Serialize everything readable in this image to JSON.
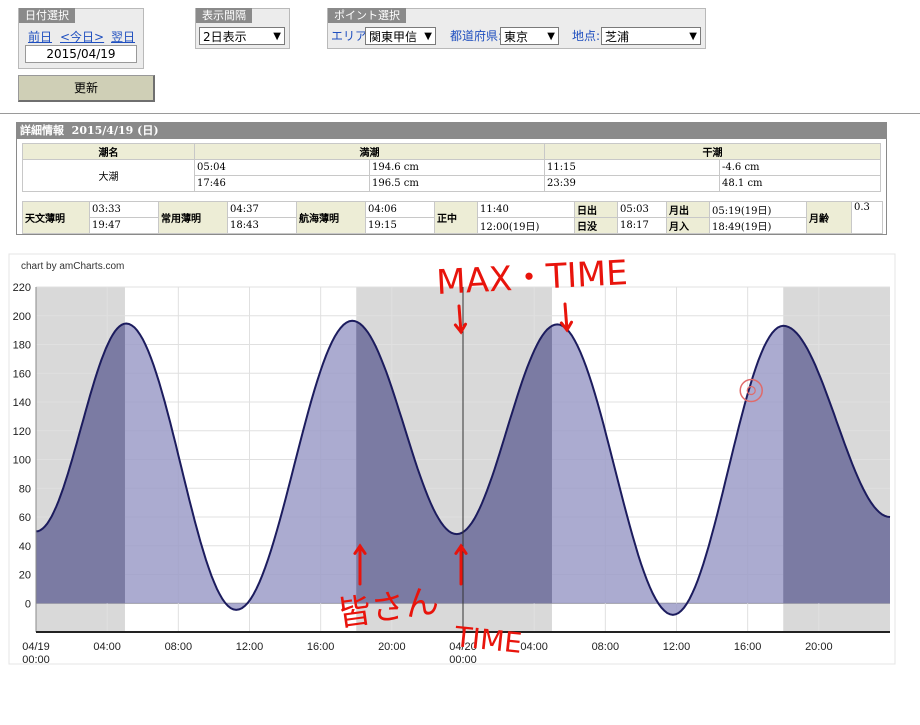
{
  "date_select": {
    "title": "日付選択",
    "prev": "前日",
    "today": "<今日>",
    "next": "翌日",
    "date": "2015/04/19"
  },
  "interval": {
    "title": "表示間隔",
    "value": "2日表示"
  },
  "point_select": {
    "title": "ポイント選択",
    "area_label": "エリア:",
    "area_value": "関東甲信",
    "pref_label": "都道府県:",
    "pref_value": "東京",
    "spot_label": "地点:",
    "spot_value": "芝浦"
  },
  "update_button": "更新",
  "details": {
    "title": "詳細情報",
    "date": "2015/4/19 (日)",
    "tide_headers": [
      "潮名",
      "満潮",
      "干潮"
    ],
    "tide_name": "大潮",
    "high": [
      {
        "time": "05:04",
        "level": "194.6 cm"
      },
      {
        "time": "17:46",
        "level": "196.5 cm"
      }
    ],
    "low": [
      {
        "time": "11:15",
        "level": "-4.6 cm"
      },
      {
        "time": "23:39",
        "level": "48.1 cm"
      }
    ],
    "info": {
      "astro_twilight": {
        "label": "天文薄明",
        "start": "03:33",
        "end": "19:47"
      },
      "civil_twilight": {
        "label": "常用薄明",
        "start": "04:37",
        "end": "18:43"
      },
      "nautical_twilight": {
        "label": "航海薄明",
        "start": "04:06",
        "end": "19:15"
      },
      "noon": {
        "label": "正中",
        "v1": "11:40",
        "v2": "12:00(19日)"
      },
      "sunrise": {
        "label": "日出",
        "value": "05:03"
      },
      "sunset": {
        "label": "日没",
        "value": "18:17"
      },
      "moonrise": {
        "label": "月出",
        "value": "05:19(19日)"
      },
      "moonset": {
        "label": "月入",
        "value": "18:49(19日)"
      },
      "moon_age": {
        "label": "月齢",
        "value": "0.3"
      }
    }
  },
  "chart_credit": "chart by amCharts.com",
  "annotations": {
    "max_time": "MAX・TIME",
    "minasan": "皆さん",
    "time": "TIME"
  },
  "colors": {
    "night_band": "#d9d9d9",
    "fill_day": "#9c9cc8",
    "fill_night": "#7b7ba3",
    "line": "#1c1c5e",
    "annotation": "#e8140c"
  },
  "chart_data": {
    "type": "area",
    "title": "",
    "xlabel": "",
    "ylabel": "",
    "ylim": [
      -20,
      220
    ],
    "yticks": [
      0,
      20,
      40,
      60,
      80,
      100,
      120,
      140,
      160,
      180,
      200,
      220
    ],
    "xrange_hours": [
      0,
      48
    ],
    "xticks": [
      {
        "h": 0,
        "label": "04/19",
        "sub": "00:00"
      },
      {
        "h": 4,
        "label": "04:00"
      },
      {
        "h": 8,
        "label": "08:00"
      },
      {
        "h": 12,
        "label": "12:00"
      },
      {
        "h": 16,
        "label": "16:00"
      },
      {
        "h": 20,
        "label": "20:00"
      },
      {
        "h": 24,
        "label": "04/20",
        "sub": "00:00"
      },
      {
        "h": 28,
        "label": "04:00"
      },
      {
        "h": 32,
        "label": "08:00"
      },
      {
        "h": 36,
        "label": "12:00"
      },
      {
        "h": 40,
        "label": "16:00"
      },
      {
        "h": 44,
        "label": "20:00"
      }
    ],
    "night_bands_hours": [
      [
        0,
        5.0
      ],
      [
        18.0,
        29.0
      ],
      [
        42.0,
        48
      ]
    ],
    "extrema": [
      {
        "h": 0,
        "v": 50
      },
      {
        "h": 5.07,
        "v": 194.6
      },
      {
        "h": 11.25,
        "v": -4.6
      },
      {
        "h": 17.77,
        "v": 196.5
      },
      {
        "h": 23.65,
        "v": 48.1
      },
      {
        "h": 29.3,
        "v": 194
      },
      {
        "h": 35.8,
        "v": -8
      },
      {
        "h": 42.0,
        "v": 193
      },
      {
        "h": 48,
        "v": 60
      }
    ],
    "cursor_hour": 24,
    "marker": {
      "h": 40.2,
      "v": 148
    }
  }
}
